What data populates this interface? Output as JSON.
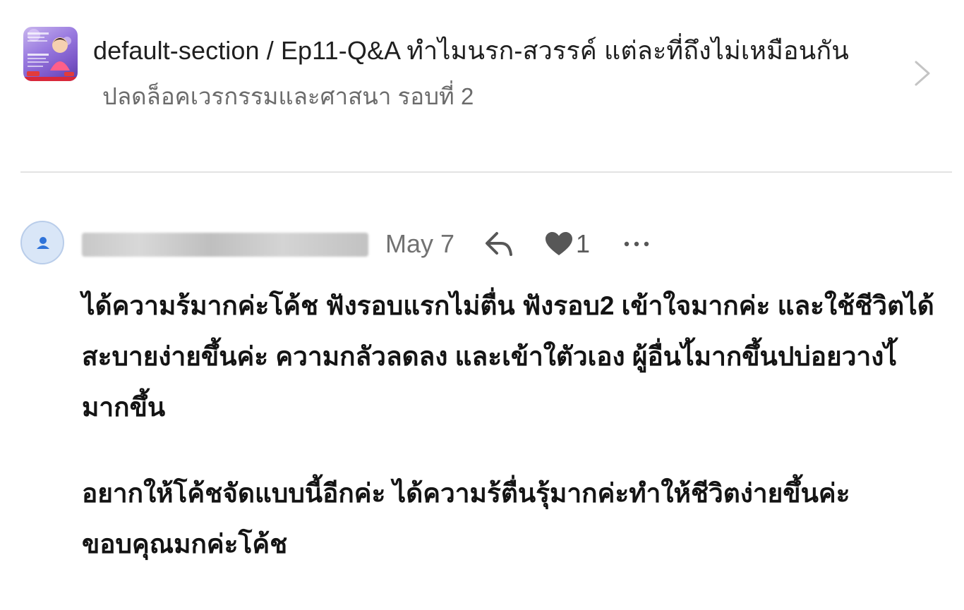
{
  "episode": {
    "title": "default-section / Ep11-Q&A ทำไมนรก-สวรรค์ แต่ละที่ถึงไม่เหมือนกัน",
    "subtitle": "ปลดล็อคเวรกรรมและศาสนา รอบที่ 2",
    "thumbnail_icon": "episode-cover-image",
    "chevron_icon": "chevron-right-icon"
  },
  "comment": {
    "avatar_icon": "user-avatar-icon",
    "author": "",
    "date": "May 7",
    "reply_icon": "reply-arrow-icon",
    "like_icon": "heart-icon",
    "like_count": "1",
    "more_icon": "more-horizontal-icon",
    "paragraphs": [
      "ได้ความร้มากค่ะโค้ช ฟังรอบแรกไม่ตื่น ฟังรอบ2 เข้าใจมากค่ะ และใช้ชีวิตได้สะบายง่ายขึ้นค่ะ ความกลัวลดลง และเข้าใตัวเอง ผู้อื่นไ้มากขึ้นปบ่อยวางไ้มากขึ้น",
      "อยากให้โค้ชจัดแบบนี้อีกค่ะ ได้ความร้ตื่นรุ้มากค่ะทำให้ชีวิตง่ายขึ้นค่ะ ขอบคุณมกค่ะโค้ช"
    ]
  },
  "colors": {
    "text_primary": "#141414",
    "text_secondary": "#6b6b6b",
    "icon_gray": "#575757",
    "divider": "#e3e3e3",
    "avatar_bg": "#d9e6f7",
    "avatar_icon": "#2f73d9"
  }
}
